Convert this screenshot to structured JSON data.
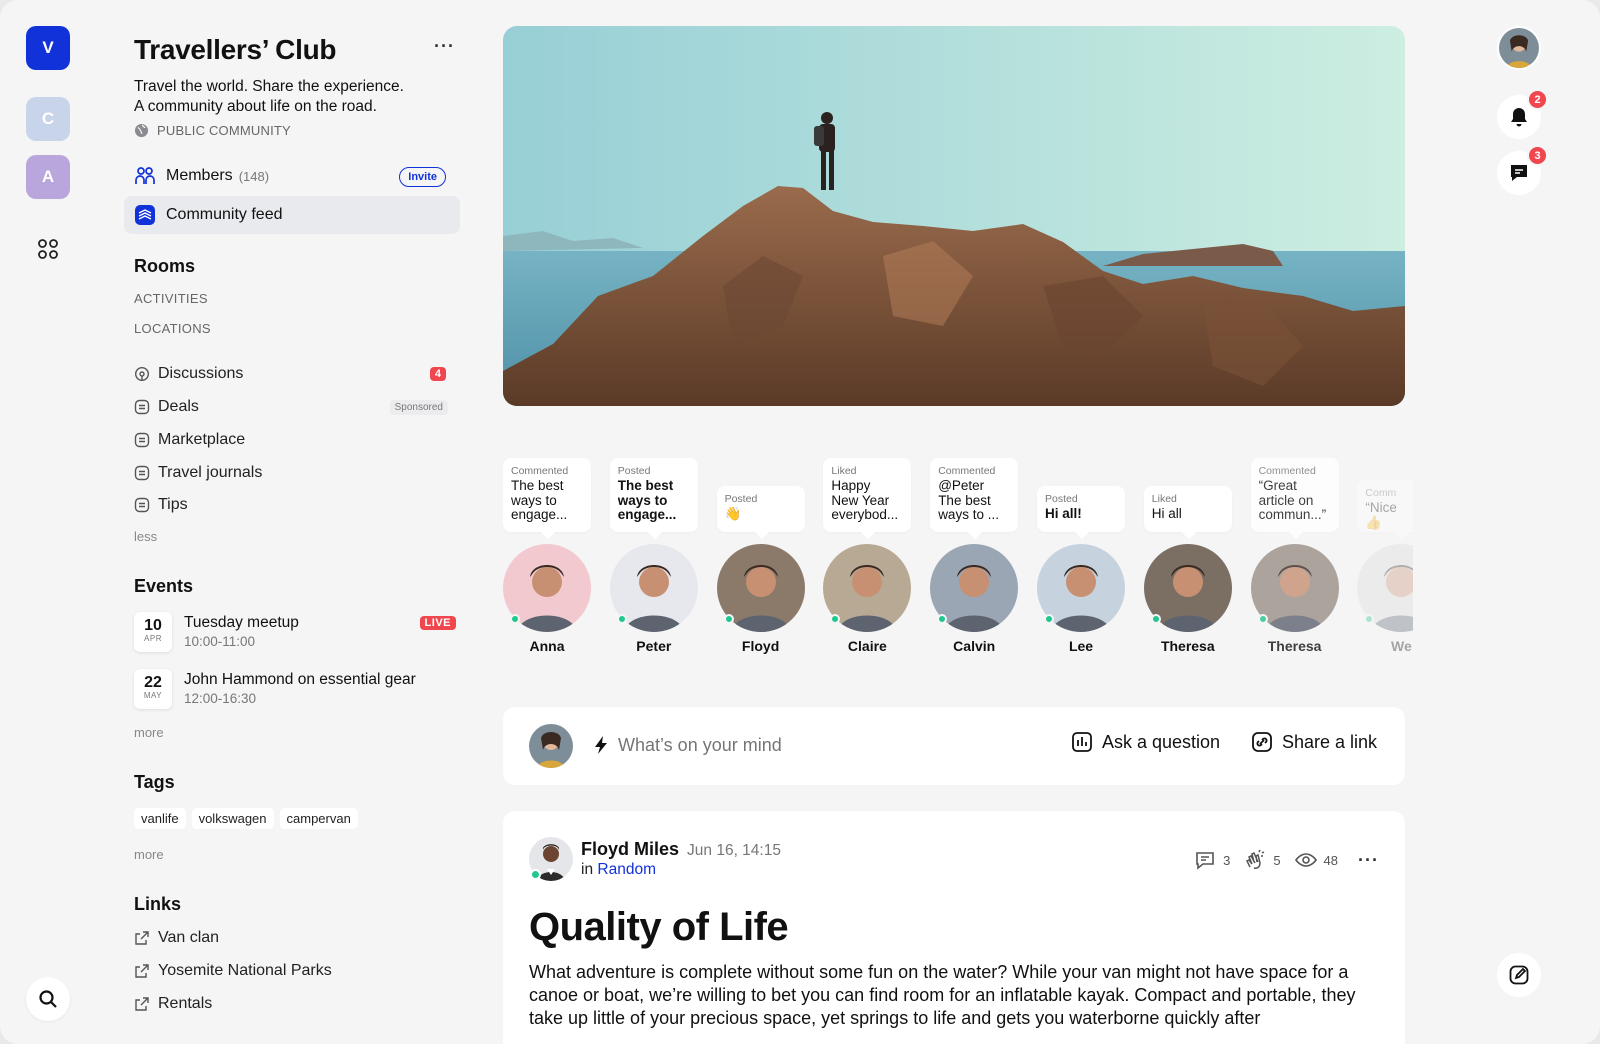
{
  "rail": {
    "workspaces": [
      {
        "letter": "V"
      },
      {
        "letter": "C"
      },
      {
        "letter": "A"
      }
    ]
  },
  "community": {
    "title": "Travellers’ Club",
    "description_line1": "Travel the world. Share the experience.",
    "description_line2": "A community about life on the road.",
    "visibility": "PUBLIC COMMUNITY"
  },
  "nav": {
    "members_label": "Members",
    "members_count": "(148)",
    "invite_label": "Invite",
    "feed_label": "Community feed"
  },
  "rooms": {
    "heading": "Rooms",
    "categories": [
      "ACTIVITIES",
      "LOCATIONS"
    ],
    "items": [
      {
        "label": "Discussions",
        "badge": "4"
      },
      {
        "label": "Deals",
        "tag": "Sponsored"
      },
      {
        "label": "Marketplace"
      },
      {
        "label": "Travel journals"
      },
      {
        "label": "Tips"
      }
    ],
    "less_label": "less"
  },
  "events": {
    "heading": "Events",
    "items": [
      {
        "day": "10",
        "month": "APR",
        "name": "Tuesday meetup",
        "time": "10:00-11:00",
        "live": "LIVE"
      },
      {
        "day": "22",
        "month": "MAY",
        "name": "John Hammond on essential gear",
        "time": "12:00-16:30"
      }
    ],
    "more_label": "more"
  },
  "tags": {
    "heading": "Tags",
    "items": [
      "vanlife",
      "volkswagen",
      "campervan"
    ],
    "more_label": "more"
  },
  "links": {
    "heading": "Links",
    "items": [
      "Van clan",
      "Yosemite National Parks",
      "Rentals"
    ]
  },
  "activity": [
    {
      "verb": "Commented",
      "text": "The best\nways to\nengage...",
      "bold": false,
      "name": "Anna",
      "color": "#f2c9cf"
    },
    {
      "verb": "Posted",
      "text": "The best\nways to\nengage...",
      "bold": true,
      "name": "Peter",
      "color": "#e6e8ee"
    },
    {
      "verb": "Posted",
      "text": "👋",
      "bold": false,
      "name": "Floyd",
      "color": "#8b7a6a"
    },
    {
      "verb": "Liked",
      "text": "Happy\nNew Year\neverybod...",
      "bold": false,
      "name": "Claire",
      "color": "#b8a994"
    },
    {
      "verb": "Commented",
      "text": "@Peter\nThe best\nways to ...",
      "bold": false,
      "name": "Calvin",
      "color": "#9aa6b3"
    },
    {
      "verb": "Posted",
      "text": "Hi all!",
      "bold": true,
      "name": "Lee",
      "color": "#c6d3df"
    },
    {
      "verb": "Liked",
      "text": "Hi all",
      "bold": false,
      "name": "Theresa",
      "color": "#7b6e63"
    },
    {
      "verb": "Commented",
      "text": "“Great\narticle on\ncommun...”",
      "bold": false,
      "name": "Theresa",
      "color": "#9b8f86"
    },
    {
      "verb": "Comm",
      "text": "“Nice\n👍",
      "bold": false,
      "name": "We",
      "color": "#d9d9dc"
    }
  ],
  "composer": {
    "placeholder": "What’s on your mind",
    "ask_label": "Ask a question",
    "share_label": "Share a link"
  },
  "post": {
    "author": "Floyd Miles",
    "date": "Jun 16, 14:15",
    "in_prefix": "in",
    "room": "Random",
    "comments": "3",
    "claps": "5",
    "views": "48",
    "title": "Quality of Life",
    "body": "What adventure is complete without some fun on the water? While your van might not have space for a canoe or boat, we’re willing to bet you can find room for an inflatable kayak. Compact and portable, they take up little of your precious space, yet springs to life and gets you waterborne quickly after"
  },
  "right_rail": {
    "notifications_count": "2",
    "messages_count": "3"
  },
  "colors": {
    "brand": "#1232d9",
    "alert": "#f0474f",
    "online": "#1fc88e"
  }
}
